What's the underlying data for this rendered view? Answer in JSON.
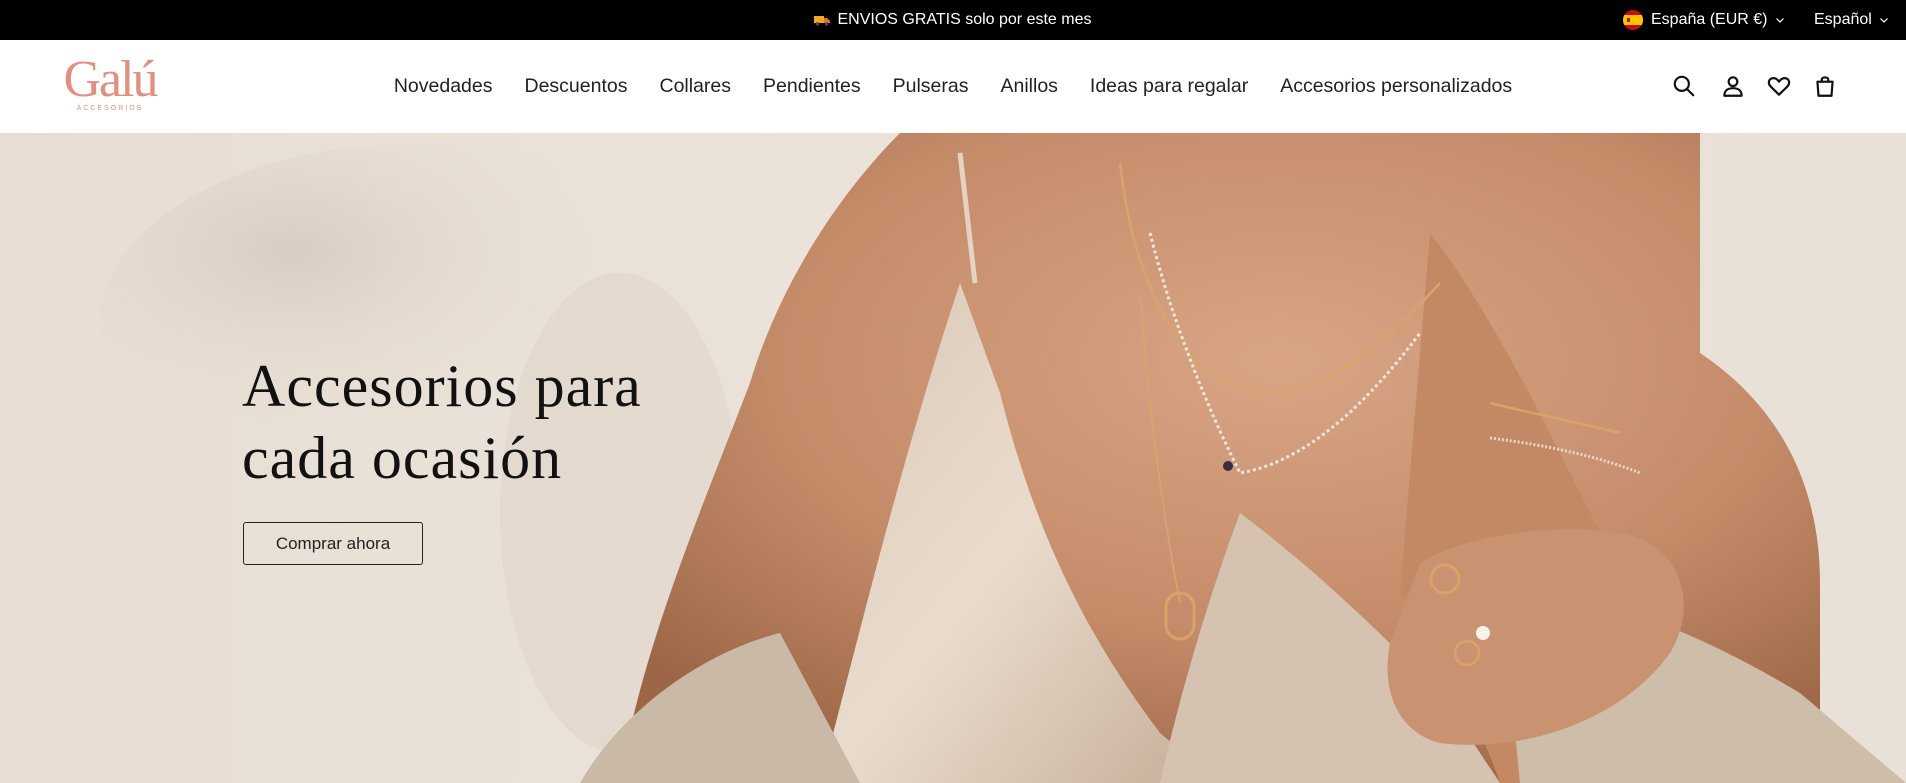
{
  "announcement": {
    "text": "ENVIOS GRATIS solo por este mes"
  },
  "locale": {
    "country": "España (EUR €)",
    "language": "Español"
  },
  "brand": {
    "name": "Galú",
    "tagline": "ACCESORIOS"
  },
  "nav": {
    "items": [
      "Novedades",
      "Descuentos",
      "Collares",
      "Pendientes",
      "Pulseras",
      "Anillos",
      "Ideas para regalar",
      "Accesorios personalizados"
    ]
  },
  "hero": {
    "title": "Accesorios para cada ocasión",
    "cta": "Comprar ahora"
  },
  "colors": {
    "accent": "#e1907f",
    "topbar": "#000000",
    "text": "#222222"
  },
  "icons": [
    "truck-icon",
    "spain-flag-icon",
    "chevron-down-icon",
    "search-icon",
    "account-icon",
    "wishlist-icon",
    "cart-icon"
  ]
}
